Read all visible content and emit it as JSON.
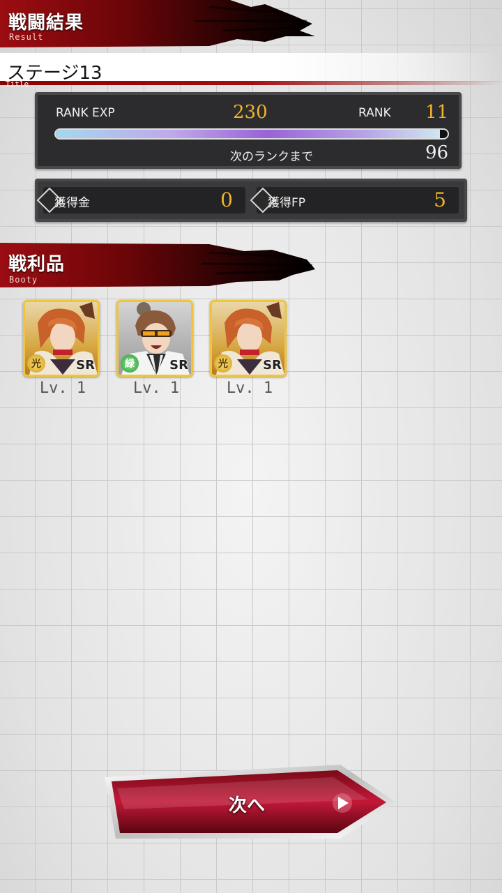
{
  "result_header": {
    "title": "戦闘結果",
    "subtitle": "Result"
  },
  "stage": {
    "title": "ステージ13",
    "subtitle": "Title"
  },
  "rank_panel": {
    "rank_exp_label": "RANK EXP",
    "rank_exp_value": "230",
    "rank_label": "RANK",
    "rank_value": "11",
    "next_rank_label": "次のランクまで",
    "next_rank_value": "96",
    "exp_progress_fraction": 0.98
  },
  "rewards": {
    "money_label": "獲得金",
    "money_value": "0",
    "fp_label": "獲得FP",
    "fp_value": "5"
  },
  "booty_header": {
    "title": "戦利品",
    "subtitle": "Booty"
  },
  "booty": [
    {
      "character": "orange-haired-fur-coat",
      "attribute_icon": "light",
      "attribute_glyph": "光",
      "rarity": "SR",
      "level": "Lv. 1"
    },
    {
      "character": "brown-haired-goggles-labcoat",
      "attribute_icon": "green",
      "attribute_glyph": "緑",
      "rarity": "SR",
      "level": "Lv. 1"
    },
    {
      "character": "orange-haired-fur-coat",
      "attribute_icon": "light",
      "attribute_glyph": "光",
      "rarity": "SR",
      "level": "Lv. 1"
    }
  ],
  "next_button": {
    "label": "次へ"
  },
  "colors": {
    "accent_red": "#a30e12",
    "gold": "#f0b52a",
    "panel": "#2c2c2e"
  }
}
